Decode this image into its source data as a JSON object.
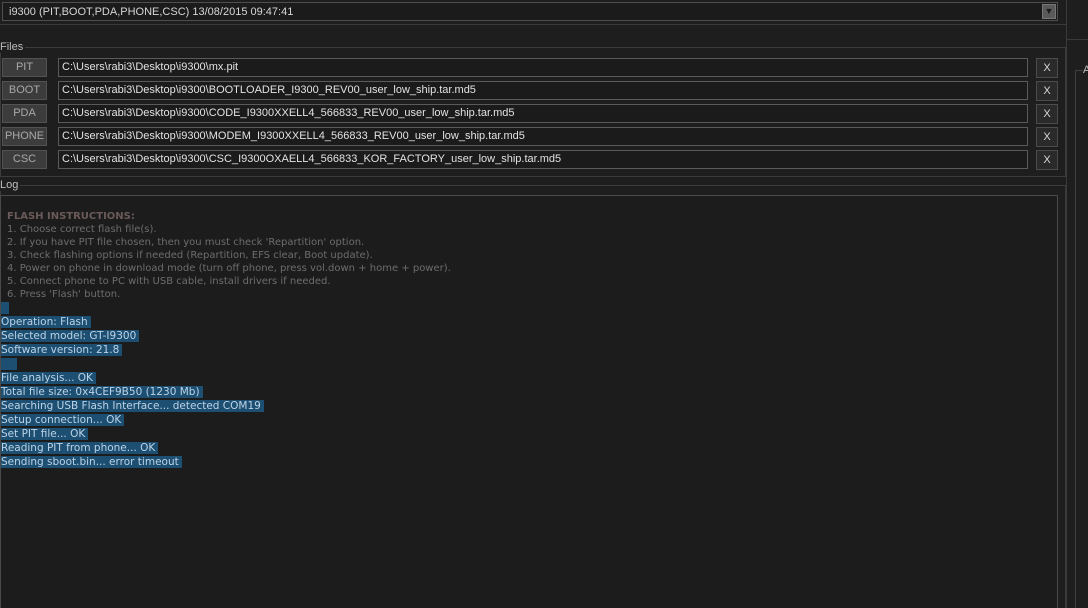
{
  "firmware_select": {
    "value": "i9300 (PIT,BOOT,PDA,PHONE,CSC) 13/08/2015 09:47:41",
    "arrow": "▼"
  },
  "files_group": {
    "title": "Files",
    "rows": [
      {
        "button": "PIT",
        "path": "C:\\Users\\rabi3\\Desktop\\i9300\\mx.pit",
        "clear": "X"
      },
      {
        "button": "BOOT",
        "path": "C:\\Users\\rabi3\\Desktop\\i9300\\BOOTLOADER_I9300_REV00_user_low_ship.tar.md5",
        "clear": "X"
      },
      {
        "button": "PDA",
        "path": "C:\\Users\\rabi3\\Desktop\\i9300\\CODE_I9300XXELL4_566833_REV00_user_low_ship.tar.md5",
        "clear": "X"
      },
      {
        "button": "PHONE",
        "path": "C:\\Users\\rabi3\\Desktop\\i9300\\MODEM_I9300XXELL4_566833_REV00_user_low_ship.tar.md5",
        "clear": "X"
      },
      {
        "button": "CSC",
        "path": "C:\\Users\\rabi3\\Desktop\\i9300\\CSC_I9300OXAELL4_566833_KOR_FACTORY_user_low_ship.tar.md5",
        "clear": "X"
      }
    ]
  },
  "log_group": {
    "title": "Log",
    "instructions_title": "FLASH INSTRUCTIONS:",
    "instructions": [
      "1. Choose correct flash file(s).",
      "2. If you have PIT file chosen, then you must check 'Repartition' option.",
      "3. Check flashing options if needed (Repartition, EFS clear, Boot update).",
      "4. Power on phone in download mode (turn off phone, press vol.down + home + power).",
      "5. Connect phone to PC with USB cable, install drivers if needed.",
      "6. Press 'Flash' button."
    ],
    "op_lines": [
      "Operation: Flash",
      "Selected model: GT-I9300",
      "Software version: 21.8"
    ],
    "progress_lines": [
      "File analysis... OK",
      "Total file size: 0x4CEF9B50 (1230 Mb)",
      "Searching USB Flash Interface... detected COM19",
      "Setup connection... OK",
      "Set PIT file... OK",
      "Reading PIT from phone... OK",
      "Sending sboot.bin... error timeout"
    ]
  },
  "right_panel": {
    "label": "A"
  },
  "colors": {
    "background": "#1e1e1e",
    "selection": "#1d4f73",
    "input_border": "#5a5a5a"
  }
}
